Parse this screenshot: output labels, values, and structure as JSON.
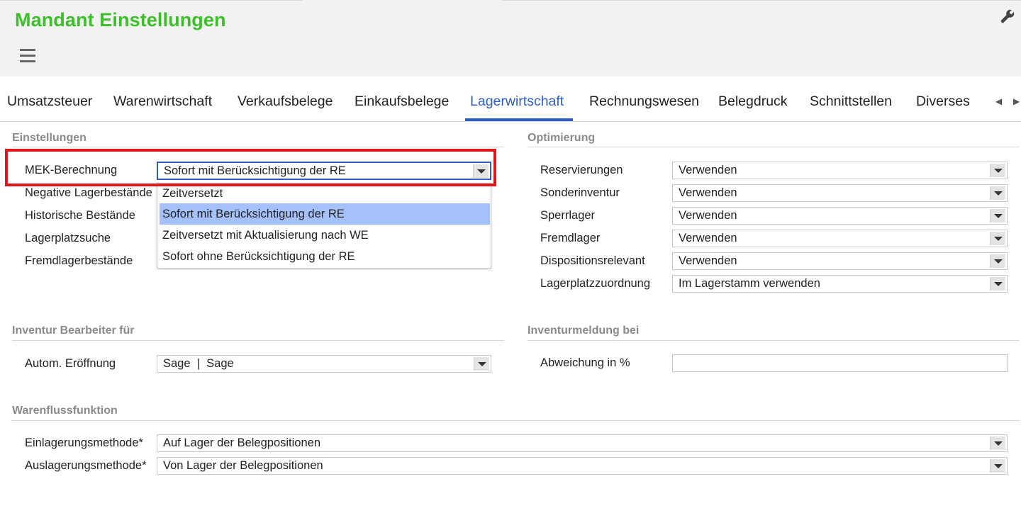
{
  "header": {
    "title": "Mandant Einstellungen",
    "menu_icon": "hamburger-icon",
    "tools_icon": "wrench-icon"
  },
  "tabs": [
    {
      "label": "Umsatzsteuer"
    },
    {
      "label": "Warenwirtschaft"
    },
    {
      "label": "Verkaufsbelege"
    },
    {
      "label": "Einkaufsbelege"
    },
    {
      "label": "Lagerwirtschaft",
      "active": true
    },
    {
      "label": "Rechnungswesen"
    },
    {
      "label": "Belegdruck"
    },
    {
      "label": "Schnittstellen"
    },
    {
      "label": "Diverses"
    }
  ],
  "einstellungen": {
    "title": "Einstellungen",
    "fields": [
      {
        "label": "MEK-Berechnung",
        "value": "Sofort mit Berücksichtigung der RE"
      },
      {
        "label": "Negative Lagerbestände"
      },
      {
        "label": "Historische Bestände"
      },
      {
        "label": "Lagerplatzsuche"
      },
      {
        "label": "Fremdlagerbestände"
      }
    ],
    "dropdown_options": [
      {
        "label": "Zeitversetzt"
      },
      {
        "label": "Sofort mit Berücksichtigung der RE",
        "selected": true
      },
      {
        "label": "Zeitversetzt mit Aktualisierung nach WE"
      },
      {
        "label": "Sofort ohne Berücksichtigung der RE"
      }
    ]
  },
  "optimierung": {
    "title": "Optimierung",
    "fields": [
      {
        "label": "Reservierungen",
        "value": "Verwenden"
      },
      {
        "label": "Sonderinventur",
        "value": "Verwenden"
      },
      {
        "label": "Sperrlager",
        "value": "Verwenden"
      },
      {
        "label": "Fremdlager",
        "value": "Verwenden"
      },
      {
        "label": "Dispositionsrelevant",
        "value": "Verwenden"
      },
      {
        "label": "Lagerplatzzuordnung",
        "value": "Im Lagerstamm verwenden"
      }
    ]
  },
  "inventur_bearbeiter": {
    "title": "Inventur Bearbeiter für",
    "field": {
      "label": "Autom. Eröffnung",
      "value": "Sage  |  Sage"
    }
  },
  "inventurmeldung": {
    "title": "Inventurmeldung bei",
    "field": {
      "label": "Abweichung in %",
      "value": ""
    }
  },
  "warenfluss": {
    "title": "Warenflussfunktion",
    "fields": [
      {
        "label": "Einlagerungsmethode*",
        "value": "Auf Lager der Belegpositionen"
      },
      {
        "label": "Auslagerungsmethode*",
        "value": "Von Lager der Belegpositionen"
      }
    ]
  },
  "colors": {
    "title_green": "#3cbf2a",
    "accent_blue": "#2c5fc0",
    "selection_blue": "#a5c1fb",
    "highlight_red": "#e0161a"
  }
}
